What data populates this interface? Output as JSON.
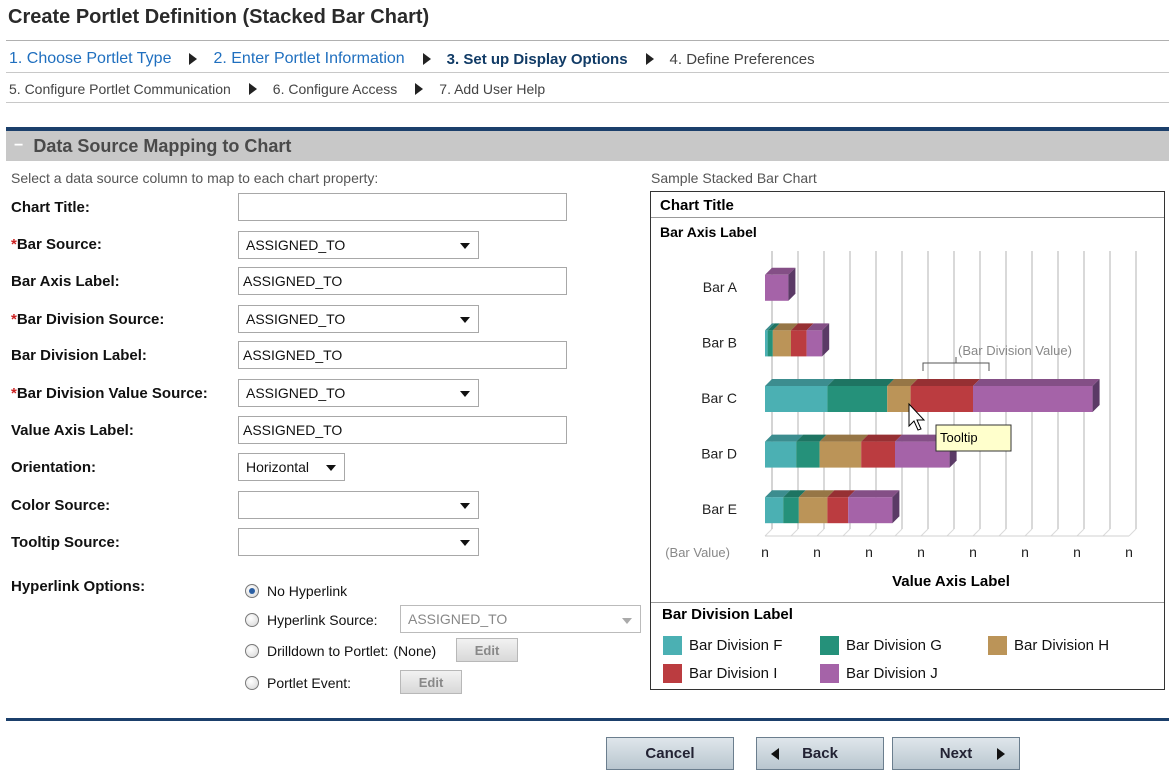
{
  "page": {
    "title": "Create Portlet Definition (Stacked Bar Chart)"
  },
  "steps": [
    {
      "label": "1. Choose Portlet Type",
      "state": "done"
    },
    {
      "label": "2. Enter Portlet Information",
      "state": "done"
    },
    {
      "label": "3. Set up Display Options",
      "state": "current"
    },
    {
      "label": "4. Define Preferences",
      "state": "todo"
    },
    {
      "label": "5. Configure Portlet Communication",
      "state": "todo"
    },
    {
      "label": "6. Configure Access",
      "state": "todo"
    },
    {
      "label": "7. Add User Help",
      "state": "todo"
    }
  ],
  "section": {
    "collapse_symbol": "−",
    "title": "Data Source Mapping to Chart",
    "intro": "Select a data source column to map to each chart property:",
    "sample_label": "Sample Stacked Bar Chart"
  },
  "form": {
    "required_mark": "*",
    "chart_title": {
      "label": "Chart Title:",
      "value": ""
    },
    "bar_source": {
      "label": "Bar Source:",
      "value": "ASSIGNED_TO"
    },
    "bar_axis_label": {
      "label": "Bar Axis Label:",
      "value": "ASSIGNED_TO"
    },
    "bar_division_source": {
      "label": "Bar Division Source:",
      "value": "ASSIGNED_TO"
    },
    "bar_division_label": {
      "label": "Bar Division Label:",
      "value": "ASSIGNED_TO"
    },
    "bar_division_value_source": {
      "label": "Bar Division Value Source:",
      "value": "ASSIGNED_TO"
    },
    "value_axis_label": {
      "label": "Value Axis Label:",
      "value": "ASSIGNED_TO"
    },
    "orientation": {
      "label": "Orientation:",
      "value": "Horizontal"
    },
    "color_source": {
      "label": "Color Source:",
      "value": ""
    },
    "tooltip_source": {
      "label": "Tooltip Source:",
      "value": ""
    },
    "hyperlink": {
      "label": "Hyperlink Options:",
      "no_hyperlink": "No Hyperlink",
      "hyperlink_source": "Hyperlink Source:",
      "hyperlink_source_value": "ASSIGNED_TO",
      "drilldown": "Drilldown to Portlet:",
      "drilldown_value": "(None)",
      "portlet_event": "Portlet Event:",
      "edit_label": "Edit",
      "selected": "no_hyperlink"
    }
  },
  "sample_chart": {
    "title": "Chart Title",
    "bar_axis_label": "Bar Axis Label",
    "value_axis_label": "Value Axis Label",
    "bar_value_label": "(Bar Value)",
    "tick_label": "n",
    "division_value_annotation": "(Bar Division Value)",
    "tooltip": "Tooltip",
    "legend_title": "Bar Division Label"
  },
  "chart_data": {
    "type": "bar",
    "orientation": "horizontal",
    "stacked": true,
    "title": "Chart Title",
    "ylabel": "Bar Axis Label",
    "xlabel": "Value Axis Label",
    "categories": [
      "Bar A",
      "Bar B",
      "Bar C",
      "Bar D",
      "Bar E"
    ],
    "ticks": [
      "n",
      "n",
      "n",
      "n",
      "n",
      "n",
      "n",
      "n"
    ],
    "xlim": [
      0,
      7
    ],
    "grid": true,
    "legend_position": "bottom",
    "series": [
      {
        "name": "Bar Division F",
        "color": "#4bb0b3",
        "values": [
          0,
          0.05,
          1.2,
          0.6,
          0.35
        ]
      },
      {
        "name": "Bar Division G",
        "color": "#25917a",
        "values": [
          0,
          0.1,
          1.15,
          0.45,
          0.3
        ]
      },
      {
        "name": "Bar Division H",
        "color": "#bb9458",
        "values": [
          0,
          0.35,
          0.45,
          0.8,
          0.55
        ]
      },
      {
        "name": "Bar Division I",
        "color": "#bb3c40",
        "values": [
          0,
          0.3,
          1.2,
          0.65,
          0.4
        ]
      },
      {
        "name": "Bar Division J",
        "color": "#a563a8",
        "values": [
          0.45,
          0.3,
          2.3,
          1.05,
          0.85
        ]
      }
    ]
  },
  "buttons": {
    "cancel": "Cancel",
    "back": "Back",
    "next": "Next"
  }
}
